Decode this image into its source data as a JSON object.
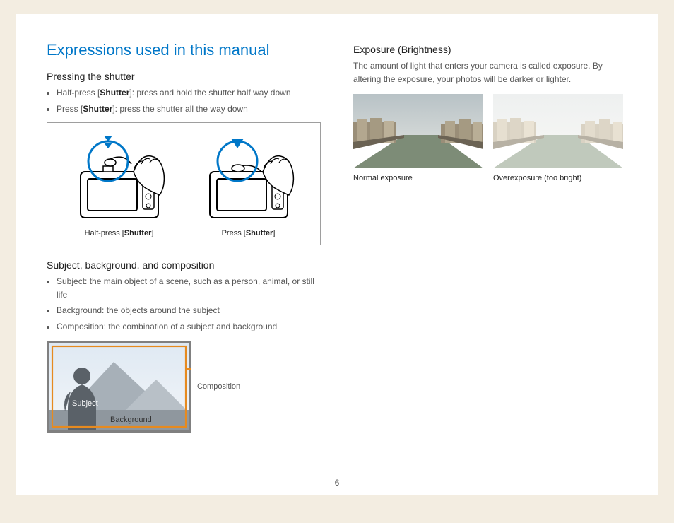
{
  "title": "Expressions used in this manual",
  "pageNumber": "6",
  "left": {
    "shutter": {
      "heading": "Pressing the shutter",
      "bullet1": {
        "pre": "Half-press [",
        "bold": "Shutter",
        "post": "]: press and hold the shutter half way down"
      },
      "bullet2": {
        "pre": "Press [",
        "bold": "Shutter",
        "post": "]: press the shutter all the way down"
      },
      "caption1": {
        "pre": "Half-press [",
        "bold": "Shutter",
        "post": "]"
      },
      "caption2": {
        "pre": "Press [",
        "bold": "Shutter",
        "post": "]"
      }
    },
    "comp": {
      "heading": "Subject, background, and composition",
      "bullet1": "Subject: the main object of a scene, such as a person, animal, or still life",
      "bullet2": "Background: the objects around the subject",
      "bullet3": "Composition: the combination of a subject and background",
      "label_subject": "Subject",
      "label_background": "Background",
      "label_composition": "Composition"
    }
  },
  "right": {
    "exposure": {
      "heading": "Exposure (Brightness)",
      "body": "The amount of light that enters your camera is called exposure. By altering the exposure, your photos will be darker or lighter.",
      "caption1": "Normal exposure",
      "caption2": "Overexposure (too bright)"
    }
  }
}
